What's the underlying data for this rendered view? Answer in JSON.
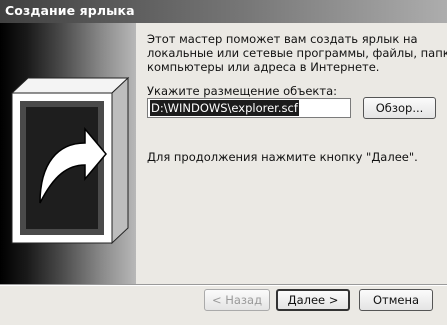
{
  "window": {
    "title": "Создание ярлыка"
  },
  "content": {
    "description_lines": [
      "Этот мастер поможет вам создать ярлык на",
      "локальные или сетевые программы, файлы, папки,",
      "компьютеры или адреса в Интернете."
    ],
    "location_label": "Укажите размещение объекта:",
    "location_value": "D:\\WINDOWS\\explorer.scf",
    "browse_label": "Обзор...",
    "continue_text": "Для продолжения нажмите кнопку \"Далее\"."
  },
  "footer": {
    "back_label": "< Назад",
    "next_label": "Далее >",
    "cancel_label": "Отмена"
  },
  "icons": {
    "side_graphic": "shortcut-arrow-icon"
  }
}
